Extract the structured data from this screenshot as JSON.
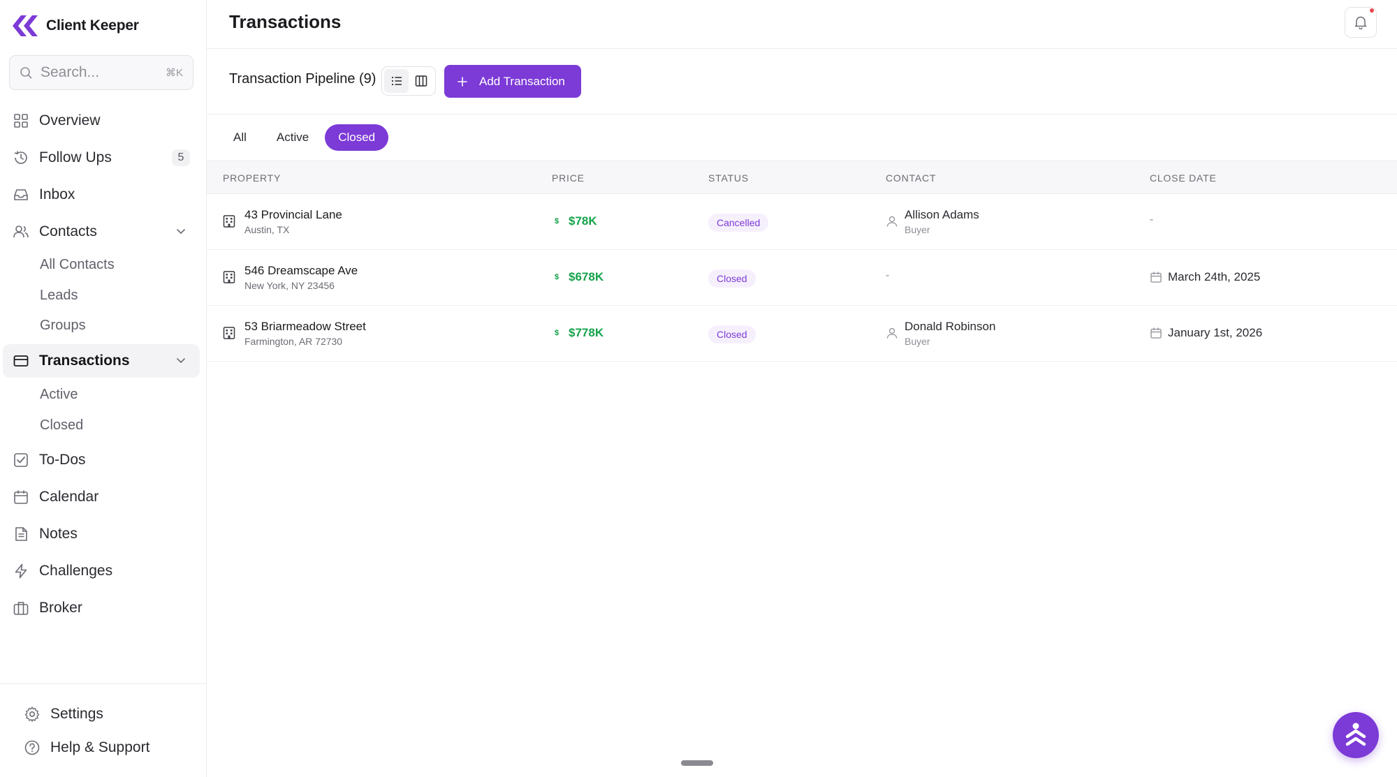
{
  "brand": {
    "name": "Client Keeper"
  },
  "search": {
    "placeholder": "Search...",
    "shortcut": "⌘K"
  },
  "sidebar": {
    "items": [
      {
        "label": "Overview",
        "icon": "grid-icon"
      },
      {
        "label": "Follow Ups",
        "icon": "history-icon",
        "badge": "5"
      },
      {
        "label": "Inbox",
        "icon": "inbox-icon"
      },
      {
        "label": "Contacts",
        "icon": "users-icon",
        "expanded": true,
        "sub": [
          "All Contacts",
          "Leads",
          "Groups"
        ]
      },
      {
        "label": "Transactions",
        "icon": "card-icon",
        "expanded": true,
        "active": true,
        "sub": [
          "Active",
          "Closed"
        ]
      },
      {
        "label": "To-Dos",
        "icon": "checkbox-icon"
      },
      {
        "label": "Calendar",
        "icon": "calendar-icon"
      },
      {
        "label": "Notes",
        "icon": "document-icon"
      },
      {
        "label": "Challenges",
        "icon": "bolt-icon"
      },
      {
        "label": "Broker",
        "icon": "briefcase-icon"
      }
    ],
    "bottom": [
      {
        "label": "Settings",
        "icon": "gear-icon"
      },
      {
        "label": "Help & Support",
        "icon": "help-circle-icon"
      }
    ]
  },
  "header": {
    "title": "Transactions"
  },
  "toolbar": {
    "pipeline_title": "Transaction Pipeline (9)",
    "add_label": "Add Transaction"
  },
  "tabs": [
    {
      "label": "All",
      "active": false
    },
    {
      "label": "Active",
      "active": false
    },
    {
      "label": "Closed",
      "active": true
    }
  ],
  "table": {
    "columns": [
      "PROPERTY",
      "PRICE",
      "STATUS",
      "CONTACT",
      "CLOSE DATE"
    ],
    "rows": [
      {
        "property": "43 Provincial Lane",
        "address": "Austin, TX",
        "currency": "$",
        "price": "$78K",
        "status": "Cancelled",
        "contact": "Allison Adams",
        "role": "Buyer",
        "close_date": "-"
      },
      {
        "property": "546 Dreamscape Ave",
        "address": "New York, NY 23456",
        "currency": "$",
        "price": "$678K",
        "status": "Closed",
        "contact": "-",
        "role": "",
        "close_date": "March 24th, 2025"
      },
      {
        "property": "53 Briarmeadow Street",
        "address": "Farmington, AR 72730",
        "currency": "$",
        "price": "$778K",
        "status": "Closed",
        "contact": "Donald Robinson",
        "role": "Buyer",
        "close_date": "January 1st, 2026"
      }
    ]
  },
  "colors": {
    "accent": "#7c3ad6",
    "price_green": "#15a34a",
    "badge_bg": "#f6f0fd",
    "notification_dot": "#e5484d"
  }
}
